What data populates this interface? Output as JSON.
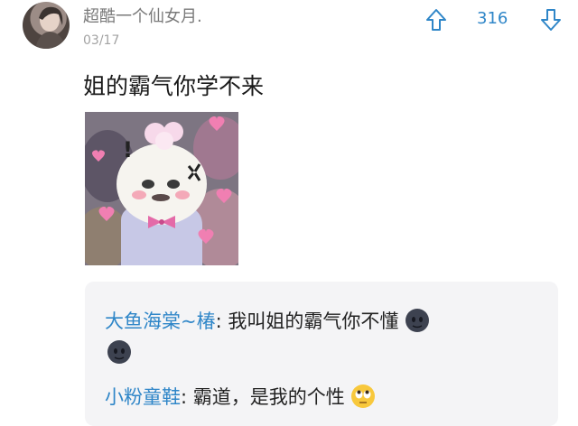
{
  "post": {
    "username": "超酷一个仙女月.",
    "date": "03/17",
    "vote_count": "316",
    "text": "姐的霸气你学不来",
    "sticker_text": "!"
  },
  "replies": [
    {
      "name": "大鱼海棠~椿",
      "separator": ": ",
      "text": "我叫姐的霸气你不懂",
      "emoji": "dark-face-emoji"
    },
    {
      "name": "小粉童鞋",
      "separator": ": ",
      "text": "霸道，是我的个性",
      "emoji": "rolling-eyes-emoji"
    }
  ],
  "colors": {
    "accent": "#2f86c8",
    "secondary_text": "#a3a3a3",
    "reply_background": "#f4f4f6"
  }
}
